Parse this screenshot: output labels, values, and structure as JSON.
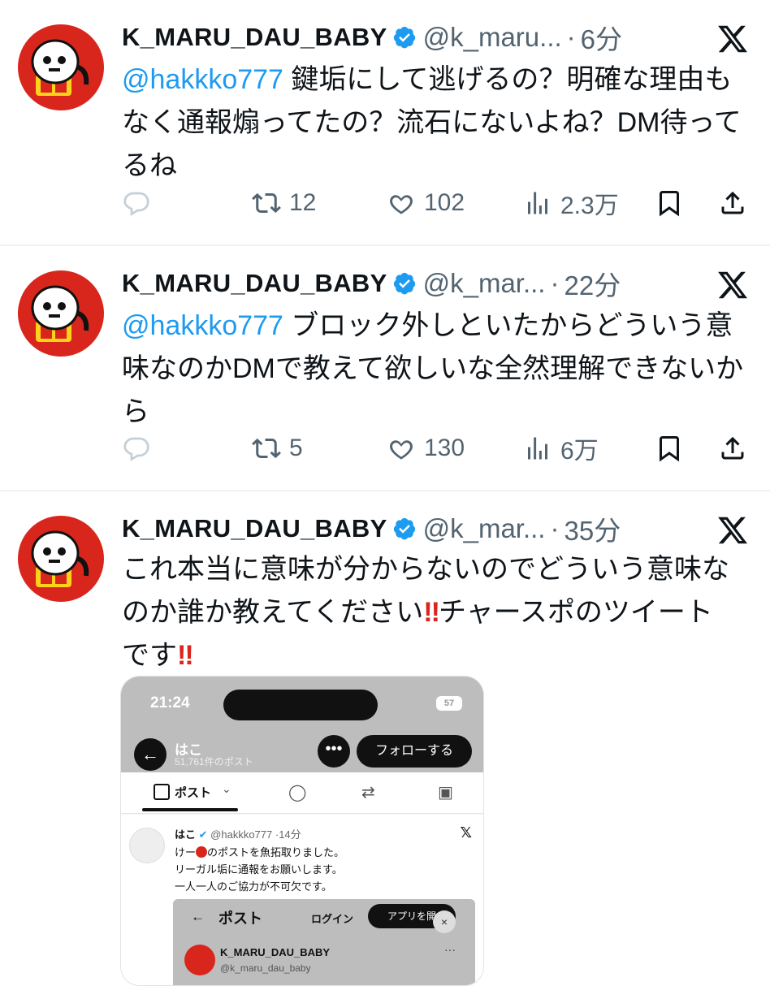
{
  "tweets": [
    {
      "name": "K_MARU_DAU_BABY",
      "handle": "@k_maru...",
      "sep": "·",
      "time": "6分",
      "mention": "@hakkko777",
      "line1": " 鍵垢にして逃げるの？明確な理由も",
      "line2": "なく通報煽ってたの？流石にないよね？DM待って",
      "line3": "るね",
      "retweets": "12",
      "likes": "102",
      "views": "2.3万"
    },
    {
      "name": "K_MARU_DAU_BABY",
      "handle": "@k_mar...",
      "sep": "·",
      "time": "22分",
      "mention": "@hakkko777",
      "line1": " ブロック外しといたからどういう意",
      "line2": "味なのかDMで教えて欲しいな全然理解できないか",
      "line3": "ら",
      "retweets": "5",
      "likes": "130",
      "views": "6万"
    },
    {
      "name": "K_MARU_DAU_BABY",
      "handle": "@k_mar...",
      "sep": "·",
      "time": "35分",
      "line1": "これ本当に意味が分からないのでどういう意味な",
      "line2a": "のか誰か教えてください",
      "bang": "!!",
      "line2b": "チャースポのツイート",
      "line3": "です"
    }
  ],
  "embed": {
    "status_time": "21:24",
    "battery": "57",
    "profile_name": "はこ",
    "post_count": "51,761件のポスト",
    "follow_label": "フォローする",
    "more_label": "•••",
    "tab_post": "ポスト",
    "tweet": {
      "name": "はこ",
      "handle": "@hakkko777",
      "time": "·14分",
      "body1a": "けー",
      "body1b": "のポストを魚拓取りました。",
      "body2": "リーガル垢に通報をお願いします。",
      "body3": "一人一人のご協力が不可欠です。"
    },
    "inner": {
      "back": "←",
      "title": "ポスト",
      "login": "ログイン",
      "app": "アプリを開",
      "close": "×",
      "name": "K_MARU_DAU_BABY",
      "handle": "@k_maru_dau_baby",
      "more": "···"
    }
  },
  "icons": {
    "reply": "reply-icon",
    "retweet": "retweet-icon",
    "like": "heart-icon",
    "views": "views-icon",
    "bookmark": "bookmark-icon",
    "share": "share-icon",
    "verified": "verified-badge-icon",
    "x": "x-logo-icon"
  },
  "colors": {
    "mention": "#1d9bf0",
    "secondary": "#536471",
    "verified": "#1d9bf0",
    "avatar_red": "#d9261c"
  }
}
